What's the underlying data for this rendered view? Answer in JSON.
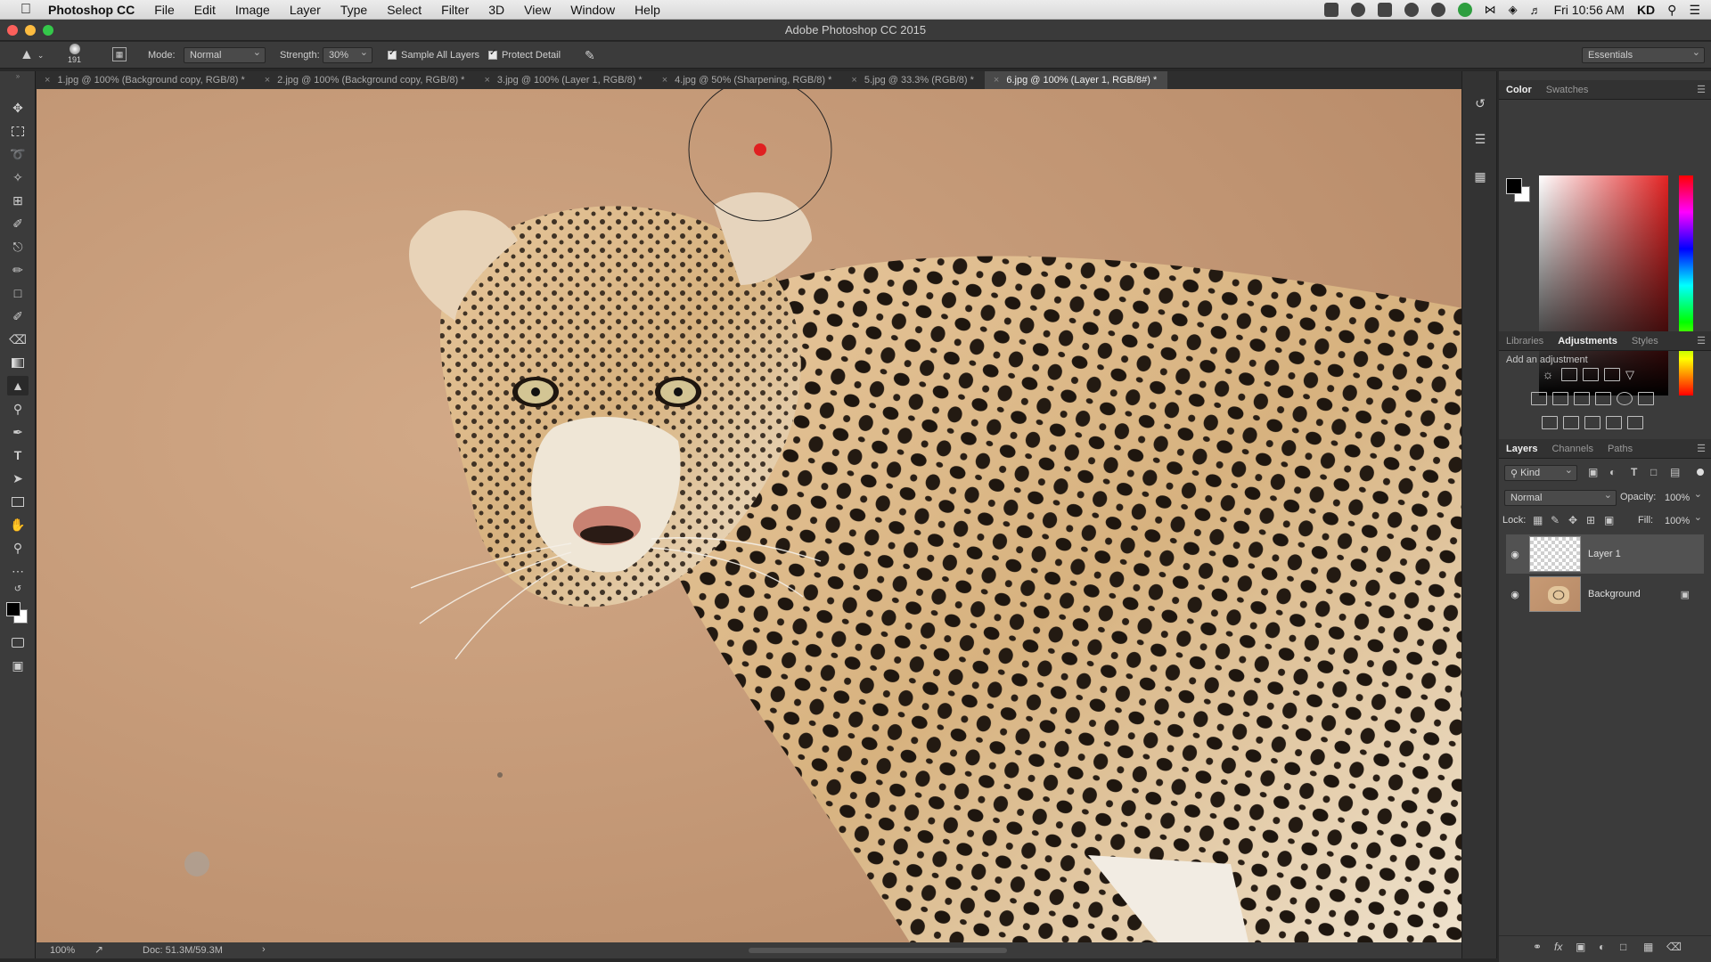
{
  "menubar": {
    "app_name": "Photoshop CC",
    "items": [
      "File",
      "Edit",
      "Image",
      "Layer",
      "Type",
      "Select",
      "Filter",
      "3D",
      "View",
      "Window",
      "Help"
    ],
    "clock": "Fri 10:56 AM",
    "user": "KD"
  },
  "window": {
    "title": "Adobe Photoshop CC 2015"
  },
  "options": {
    "brush_size": "191",
    "mode_label": "Mode:",
    "mode_value": "Normal",
    "strength_label": "Strength:",
    "strength_value": "30%",
    "sample_all_layers": "Sample All Layers",
    "protect_detail": "Protect Detail",
    "workspace": "Essentials"
  },
  "tabs": [
    {
      "label": "1.jpg @ 100% (Background copy, RGB/8) *"
    },
    {
      "label": "2.jpg @ 100% (Background copy, RGB/8) *"
    },
    {
      "label": "3.jpg @ 100% (Layer 1, RGB/8) *"
    },
    {
      "label": "4.jpg @ 50% (Sharpening, RGB/8) *"
    },
    {
      "label": "5.jpg @ 33.3% (RGB/8) *"
    },
    {
      "label": "6.jpg @ 100% (Layer 1, RGB/8#) *"
    }
  ],
  "status": {
    "zoom": "100%",
    "doc_size": "Doc: 51.3M/59.3M"
  },
  "color_panel": {
    "tabs": [
      "Color",
      "Swatches"
    ],
    "foreground": "#000000",
    "background": "#ffffff"
  },
  "adjustments_panel": {
    "tabs": [
      "Libraries",
      "Adjustments",
      "Styles"
    ],
    "heading": "Add an adjustment"
  },
  "layers_panel": {
    "tabs": [
      "Layers",
      "Channels",
      "Paths"
    ],
    "filter_kind": "Kind",
    "blend_mode": "Normal",
    "opacity_label": "Opacity:",
    "opacity_value": "100%",
    "lock_label": "Lock:",
    "fill_label": "Fill:",
    "fill_value": "100%",
    "layers": [
      {
        "name": "Layer 1",
        "selected": true
      },
      {
        "name": "Background",
        "locked": true
      }
    ]
  },
  "colors": {
    "ui_bg": "#3b3b3b",
    "canvas_bg": "#282828",
    "accent_active_tab": "#494949"
  }
}
